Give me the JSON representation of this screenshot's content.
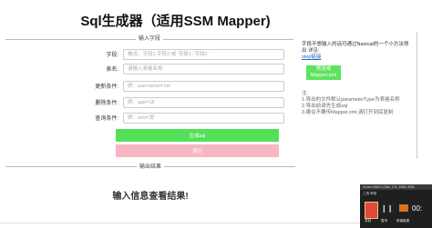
{
  "title": "Sql生成器（适用SSM Mapper)",
  "input_legend": "输入字段",
  "fields": [
    {
      "label": "字段:",
      "placeholder": "格式：字段1,字段2 或 '字段1','字段2'"
    },
    {
      "label": "表名:",
      "placeholder": "请输入表格名称"
    },
    {
      "label": "更新条件:",
      "placeholder": "例：username='cai'"
    },
    {
      "label": "删除条件:",
      "placeholder": "例：age=18"
    },
    {
      "label": "查询条件:",
      "placeholder": "例：sex='女'"
    }
  ],
  "buttons": {
    "generate": "生成sql",
    "clear": "清空"
  },
  "side": {
    "intro": "字段不想输入的话可通过Navicat的一个小方法得出 详见:",
    "link": "step链接",
    "download": "预览或Mapper.xml",
    "notes": [
      "注:",
      "1.导出的文件默认parameterType为表格名称",
      "2.导出前请先生成sql",
      "3.建议不要传Mapper.xml,请打开到底复制"
    ]
  },
  "output_legend": "输出结果",
  "output_placeholder": "输入信息查看结果!",
  "recorder": {
    "window_title": "oCam v380.0 (364, 174, 1656, 808)",
    "menu": "工具  帮助",
    "time": "00:",
    "labels": [
      "录制",
      "暂停",
      "屏幕截图"
    ]
  }
}
